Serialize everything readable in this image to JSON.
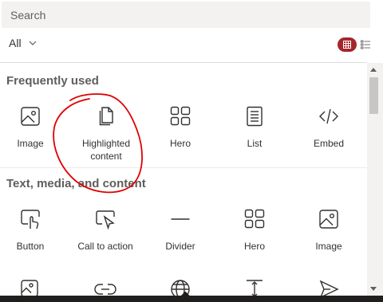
{
  "search": {
    "placeholder": "Search"
  },
  "filter": {
    "value": "All"
  },
  "sections": [
    {
      "title": "Frequently used",
      "tiles": [
        {
          "label": "Image",
          "icon": "image-icon"
        },
        {
          "label": "Highlighted\ncontent",
          "icon": "highlighted-content-icon"
        },
        {
          "label": "Hero",
          "icon": "hero-icon"
        },
        {
          "label": "List",
          "icon": "list-icon"
        },
        {
          "label": "Embed",
          "icon": "embed-icon"
        }
      ]
    },
    {
      "title": "Text, media, and content",
      "tiles": [
        {
          "label": "Button",
          "icon": "button-icon"
        },
        {
          "label": "Call to action",
          "icon": "call-to-action-icon"
        },
        {
          "label": "Divider",
          "icon": "divider-icon"
        },
        {
          "label": "Hero",
          "icon": "hero-icon"
        },
        {
          "label": "Image",
          "icon": "image-icon"
        }
      ]
    }
  ],
  "colors": {
    "accent": "#a4262c",
    "annotation": "#e00000"
  }
}
